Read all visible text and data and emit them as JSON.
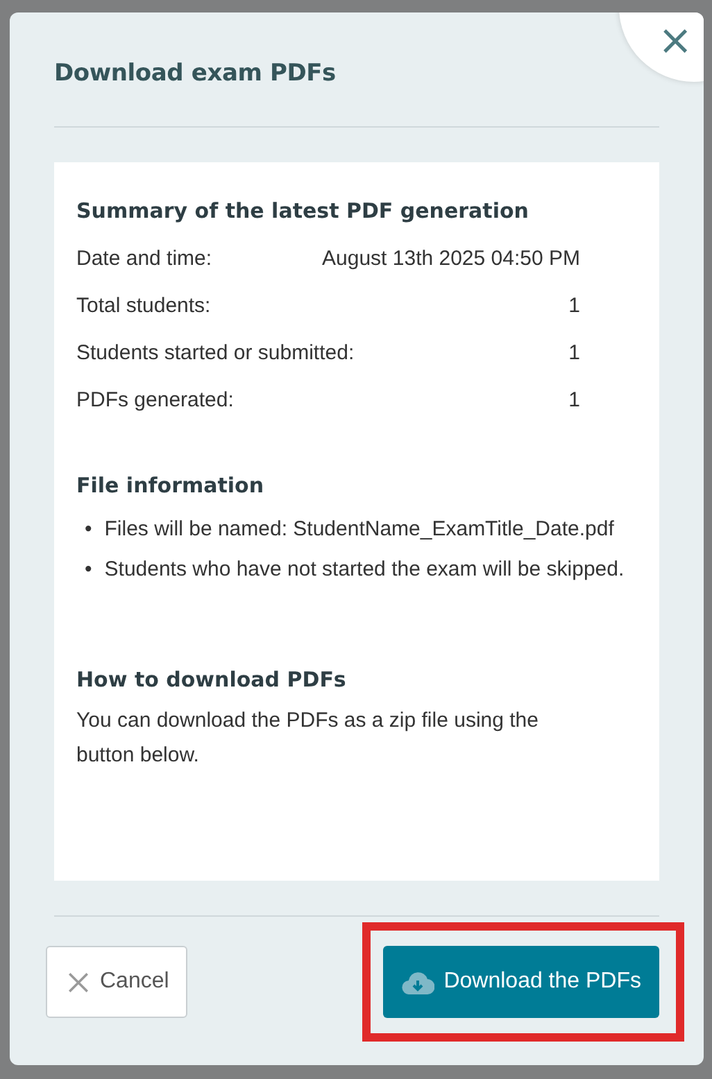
{
  "dialog": {
    "title": "Download exam PDFs",
    "close_icon": "×"
  },
  "summary": {
    "heading": "Summary of the latest PDF generation",
    "rows": [
      {
        "label": "Date and time:",
        "value": "August 13th 2025 04:50 PM"
      },
      {
        "label": "Total students:",
        "value": "1"
      },
      {
        "label": "Students started or submitted:",
        "value": "1"
      },
      {
        "label": "PDFs generated:",
        "value": "1"
      }
    ]
  },
  "file_info": {
    "heading": "File information",
    "marker": "•",
    "bullets": [
      "Files will be named: StudentName_ExamTitle_Date.pdf",
      "Students who have not started the exam will be skipped."
    ]
  },
  "how_to": {
    "heading": "How to download PDFs",
    "text": "You can download the PDFs as a zip file using the button below."
  },
  "buttons": [
    {
      "kind": "secondary",
      "label": "Cancel",
      "highlighted": false
    },
    {
      "kind": "primary",
      "label": "Download the PDFs",
      "highlighted": true
    }
  ]
}
